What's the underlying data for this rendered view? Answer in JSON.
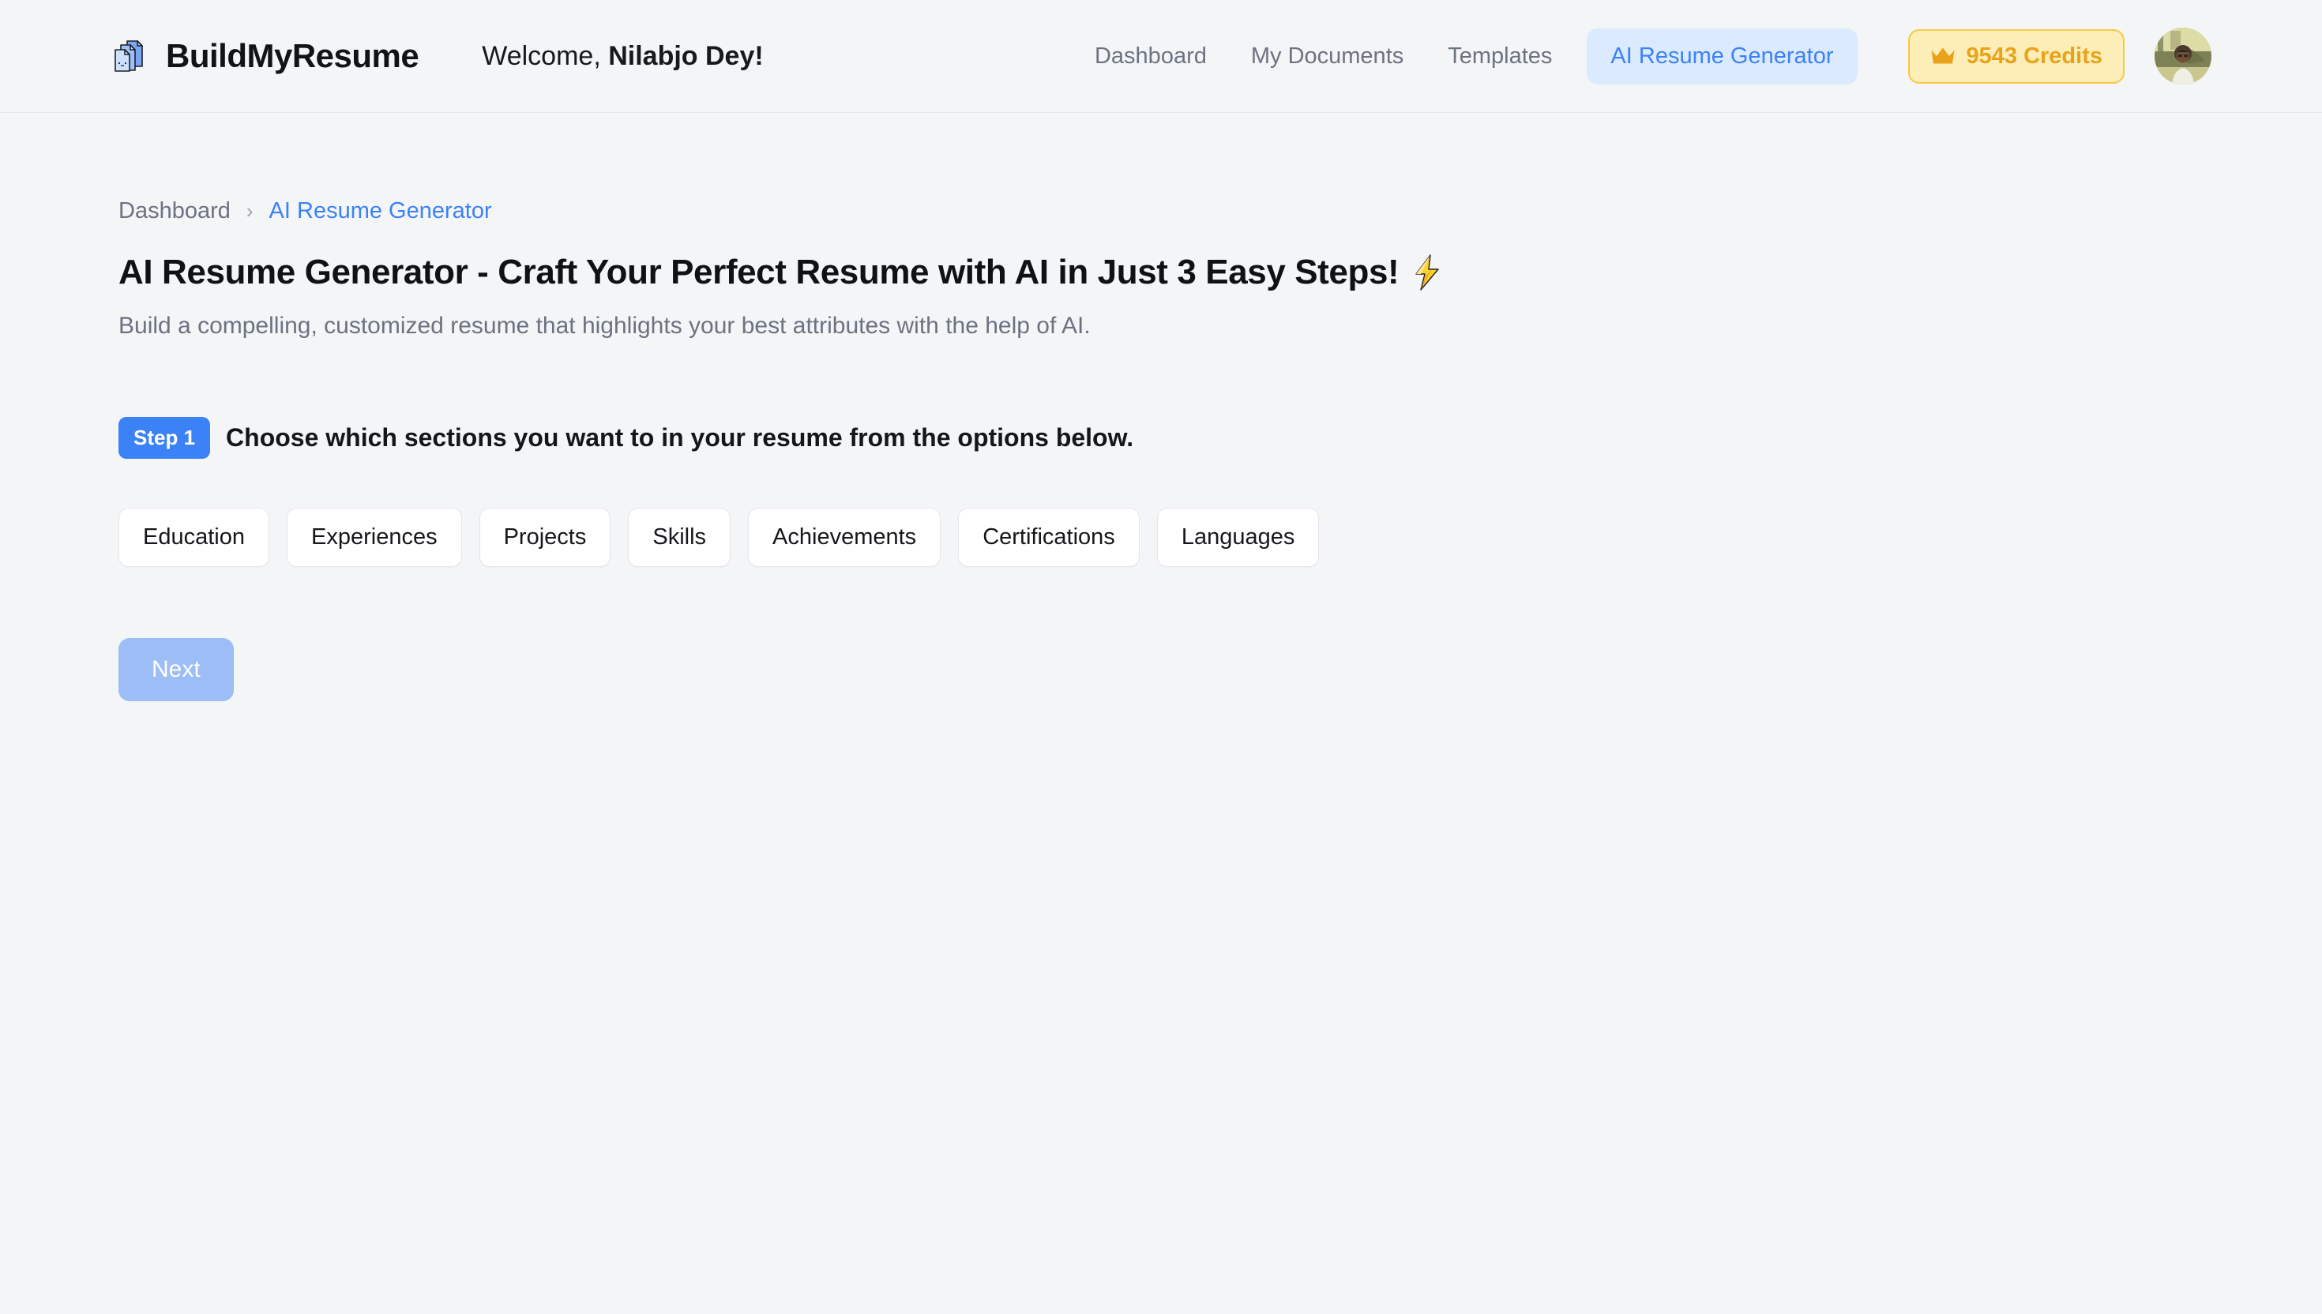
{
  "header": {
    "brand_name": "BuildMyResume",
    "logo_icon": "stacked-documents-icon",
    "welcome_prefix": "Welcome, ",
    "welcome_name": "Nilabjo Dey!",
    "nav_items": [
      {
        "label": "Dashboard",
        "active": false
      },
      {
        "label": "My Documents",
        "active": false
      },
      {
        "label": "Templates",
        "active": false
      },
      {
        "label": "AI Resume Generator",
        "active": true
      }
    ],
    "credits": {
      "icon": "crown-icon",
      "label": "9543 Credits",
      "bg_color": "#fdeeb8",
      "border_color": "#f6c945",
      "text_color": "#e9a21a"
    },
    "avatar": {
      "icon": "user-avatar",
      "alt": "Profile photo"
    },
    "active_pill_bg": "#dbeafe",
    "active_pill_text": "#3b82f6"
  },
  "breadcrumb": {
    "root": "Dashboard",
    "separator": "›",
    "current": "AI Resume Generator"
  },
  "page": {
    "title": "AI Resume Generator - Craft Your Perfect Resume with AI in Just 3 Easy Steps!",
    "title_icon": "high-voltage-bolt-icon",
    "subtitle": "Build a compelling, customized resume that highlights your best attributes with the help of AI."
  },
  "step": {
    "badge": "Step 1",
    "badge_color": "#3b82f6",
    "instruction": "Choose which sections you want to in your resume from the options below."
  },
  "sections": [
    {
      "label": "Education",
      "selected": false
    },
    {
      "label": "Experiences",
      "selected": false
    },
    {
      "label": "Projects",
      "selected": false
    },
    {
      "label": "Skills",
      "selected": false
    },
    {
      "label": "Achievements",
      "selected": false
    },
    {
      "label": "Certifications",
      "selected": false
    },
    {
      "label": "Languages",
      "selected": false
    }
  ],
  "actions": {
    "next_label": "Next",
    "next_enabled": false,
    "next_color": "#9cbdf5"
  }
}
